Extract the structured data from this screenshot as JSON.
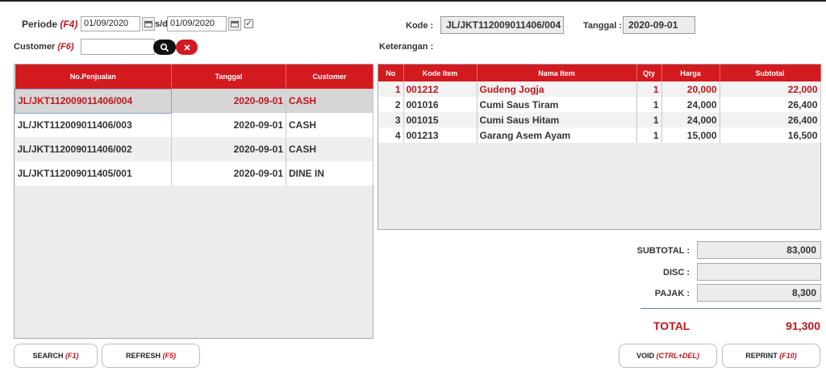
{
  "filters": {
    "periode_label": "Periode",
    "periode_key": "(F4)",
    "date_from": "01/09/2020",
    "sd_label": "s/d",
    "date_to": "01/09/2020",
    "date_checkbox_mark": "✓",
    "customer_label": "Customer",
    "customer_key": "(F6)",
    "customer_value": "",
    "search_icon": "search-icon",
    "clear_icon": "close-icon"
  },
  "header": {
    "kode_label": "Kode :",
    "kode_value": "JL/JKT112009011406/004",
    "tanggal_label": "Tanggal :",
    "tanggal_value": "2020-09-01",
    "keterangan_label": "Keterangan :"
  },
  "sales_table": {
    "columns": [
      "No.Penjualan",
      "Tanggal",
      "Customer"
    ],
    "rows": [
      {
        "no": "JL/JKT112009011406/004",
        "tanggal": "2020-09-01",
        "customer": "CASH"
      },
      {
        "no": "JL/JKT112009011406/003",
        "tanggal": "2020-09-01",
        "customer": "CASH"
      },
      {
        "no": "JL/JKT112009011406/002",
        "tanggal": "2020-09-01",
        "customer": "CASH"
      },
      {
        "no": "JL/JKT112009011405/001",
        "tanggal": "2020-09-01",
        "customer": "DINE IN"
      }
    ]
  },
  "items_table": {
    "columns": [
      "No",
      "Kode Item",
      "Nama Item",
      "Qty",
      "Harga",
      "Subtotal"
    ],
    "rows": [
      {
        "no": "1",
        "kode": "001212",
        "nama": "Gudeng Jogja",
        "qty": "1",
        "harga": "20,000",
        "subtotal": "22,000"
      },
      {
        "no": "2",
        "kode": "001016",
        "nama": "Cumi Saus Tiram",
        "qty": "1",
        "harga": "24,000",
        "subtotal": "26,400"
      },
      {
        "no": "3",
        "kode": "001015",
        "nama": "Cumi Saus Hitam",
        "qty": "1",
        "harga": "24,000",
        "subtotal": "26,400"
      },
      {
        "no": "4",
        "kode": "001213",
        "nama": "Garang Asem Ayam",
        "qty": "1",
        "harga": "15,000",
        "subtotal": "16,500"
      }
    ]
  },
  "totals": {
    "subtotal_label": "SUBTOTAL :",
    "subtotal_value": "83,000",
    "disc_label": "DISC :",
    "disc_value": "",
    "pajak_label": "PAJAK :",
    "pajak_value": "8,300",
    "total_label": "TOTAL",
    "total_value": "91,300"
  },
  "buttons": {
    "search_label": "SEARCH",
    "search_key": "(F1)",
    "refresh_label": "REFRESH",
    "refresh_key": "(F5)",
    "void_label": "VOID",
    "void_key": "(CTRL+DEL)",
    "reprint_label": "REPRINT",
    "reprint_key": "(F10)"
  },
  "colors": {
    "accent_red": "#d31a1f",
    "text_red": "#c0151b",
    "panel_gray": "#ececec"
  }
}
